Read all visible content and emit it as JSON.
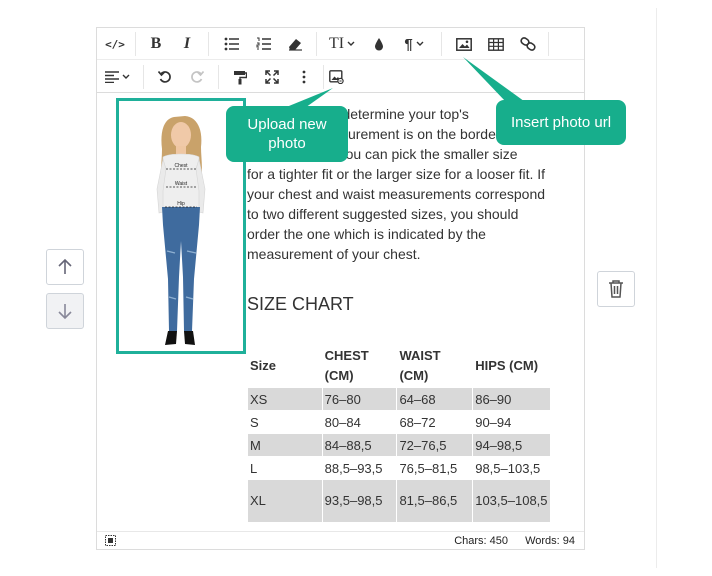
{
  "toolbar": {
    "row1": [
      {
        "name": "source-code-icon",
        "glyph": "</>"
      },
      {
        "name": "bold-icon",
        "glyph": "B"
      },
      {
        "name": "italic-icon",
        "glyph": "I"
      },
      {
        "name": "bulleted-list-icon"
      },
      {
        "name": "numbered-list-icon"
      },
      {
        "name": "eraser-icon"
      },
      {
        "name": "font-size-icon",
        "glyph": "TI"
      },
      {
        "name": "color-drop-icon"
      },
      {
        "name": "paragraph-icon",
        "glyph": "¶"
      },
      {
        "name": "image-icon"
      },
      {
        "name": "table-icon"
      },
      {
        "name": "link-icon"
      }
    ],
    "row2": [
      {
        "name": "align-icon"
      },
      {
        "name": "undo-icon"
      },
      {
        "name": "redo-icon"
      },
      {
        "name": "format-painter-icon"
      },
      {
        "name": "fullscreen-icon"
      },
      {
        "name": "more-options-icon"
      },
      {
        "name": "image-url-icon"
      }
    ]
  },
  "content": {
    "paragraph_lines": [
      "s to determine your top's",
      "surement is on the borde",
      "es, you can pick the smaller size",
      "for a tighter fit or the larger size for a looser fit. If",
      "your chest and waist measurements correspond",
      "to two different suggested sizes, you should",
      "order the one which is indicated by the",
      "measurement of your chest."
    ],
    "heading": "SIZE CHART",
    "photo_labels": {
      "chest": "Chest",
      "waist": "Waist",
      "hip": "Hip"
    }
  },
  "size_chart": {
    "headers": [
      "Size",
      "CHEST (CM)",
      "WAIST (CM)",
      "HIPS (CM)"
    ],
    "rows": [
      [
        "XS",
        "76–80",
        "64–68",
        "86–90"
      ],
      [
        "S",
        "80–84",
        "68–72",
        "90–94"
      ],
      [
        "M",
        "84–88,5",
        "72–76,5",
        "94–98,5"
      ],
      [
        "L",
        "88,5–93,5",
        "76,5–81,5",
        "98,5–103,5"
      ],
      [
        "XL",
        "93,5–98,5",
        "81,5–86,5",
        "103,5–108,5"
      ]
    ]
  },
  "tooltips": {
    "upload": "Upload new photo",
    "insert_url": "Insert photo url"
  },
  "statusbar": {
    "chars": "Chars: 450",
    "words": "Words: 94"
  },
  "colors": {
    "accent": "#17ae8c",
    "frame": "#1fb09a",
    "table_alt_row": "#d9d9d9"
  }
}
